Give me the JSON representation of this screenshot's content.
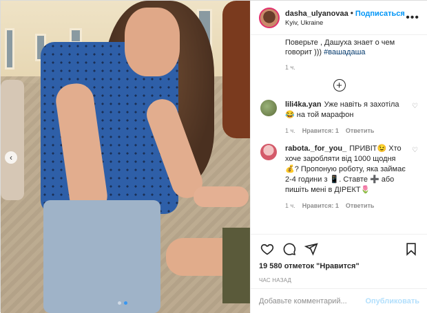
{
  "header": {
    "username": "dasha_ulyanovaa",
    "bullet": "•",
    "follow_label": "Подписаться",
    "location": "Kyiv, Ukraine",
    "more_icon": "more-horizontal-icon"
  },
  "caption": {
    "text": "Поверьте , Дашуха знает о чем говорит )))",
    "hashtag": "#вашадаша",
    "time": "1 ч."
  },
  "load_more_icon": "plus-circle-icon",
  "comments": [
    {
      "username": "lili4ka.yan",
      "text": "Уже навіть я захотіла 😂 на той марафон",
      "time": "1 ч.",
      "likes": "Нравится: 1",
      "reply": "Ответить"
    },
    {
      "username": "rabota._for_you_",
      "text": "ПРИВІТ😉 Хто хоче заробляти від 1000 щодня💰? Пропоную роботу, яка займає 2-4 години з 📱. Ставте ➕ або пишіть мені в ДІРЕКТ🌷",
      "time": "1 ч.",
      "likes": "Нравится: 1",
      "reply": "Ответить"
    }
  ],
  "actions": {
    "like_icon": "heart-icon",
    "comment_icon": "comment-icon",
    "share_icon": "send-icon",
    "save_icon": "bookmark-icon"
  },
  "likes_text": "19 580 отметок \"Нравится\"",
  "time_ago": "ЧАС НАЗАД",
  "add_comment": {
    "placeholder": "Добавьте комментарий...",
    "value": "",
    "publish_label": "Опубликовать"
  },
  "carousel": {
    "prev_icon": "chevron-left-icon",
    "dots": 2,
    "active_dot": 2
  },
  "colors": {
    "accent": "#0095f6",
    "publish_disabled": "#b2dffc",
    "muted": "#8e8e8e",
    "hashtag": "#00376b"
  }
}
